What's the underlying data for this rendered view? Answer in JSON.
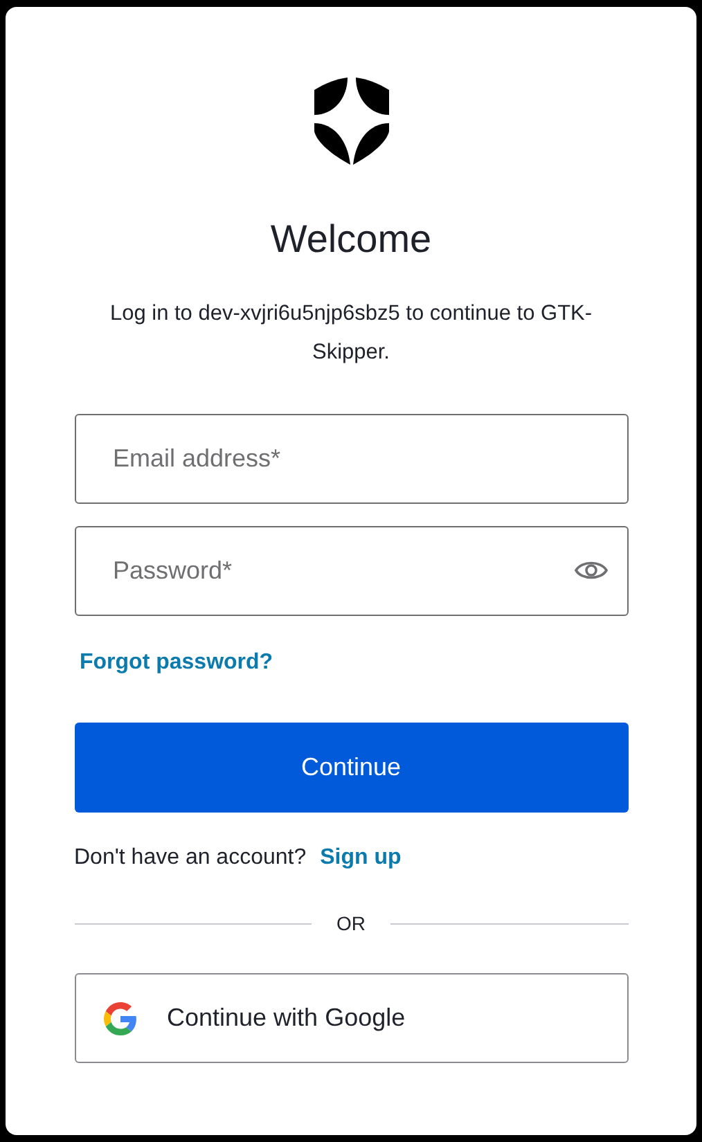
{
  "title": "Welcome",
  "description": "Log in to dev-xvjri6u5njp6sbz5 to continue to GTK-Skipper.",
  "fields": [
    {
      "kind": "email",
      "placeholder": "Email address*"
    },
    {
      "kind": "password",
      "placeholder": "Password*"
    }
  ],
  "forgot_link": "Forgot password?",
  "continue_button": "Continue",
  "signup": {
    "prompt": "Don't have an account?",
    "link": "Sign up"
  },
  "divider": "OR",
  "social_button": "Continue with Google"
}
